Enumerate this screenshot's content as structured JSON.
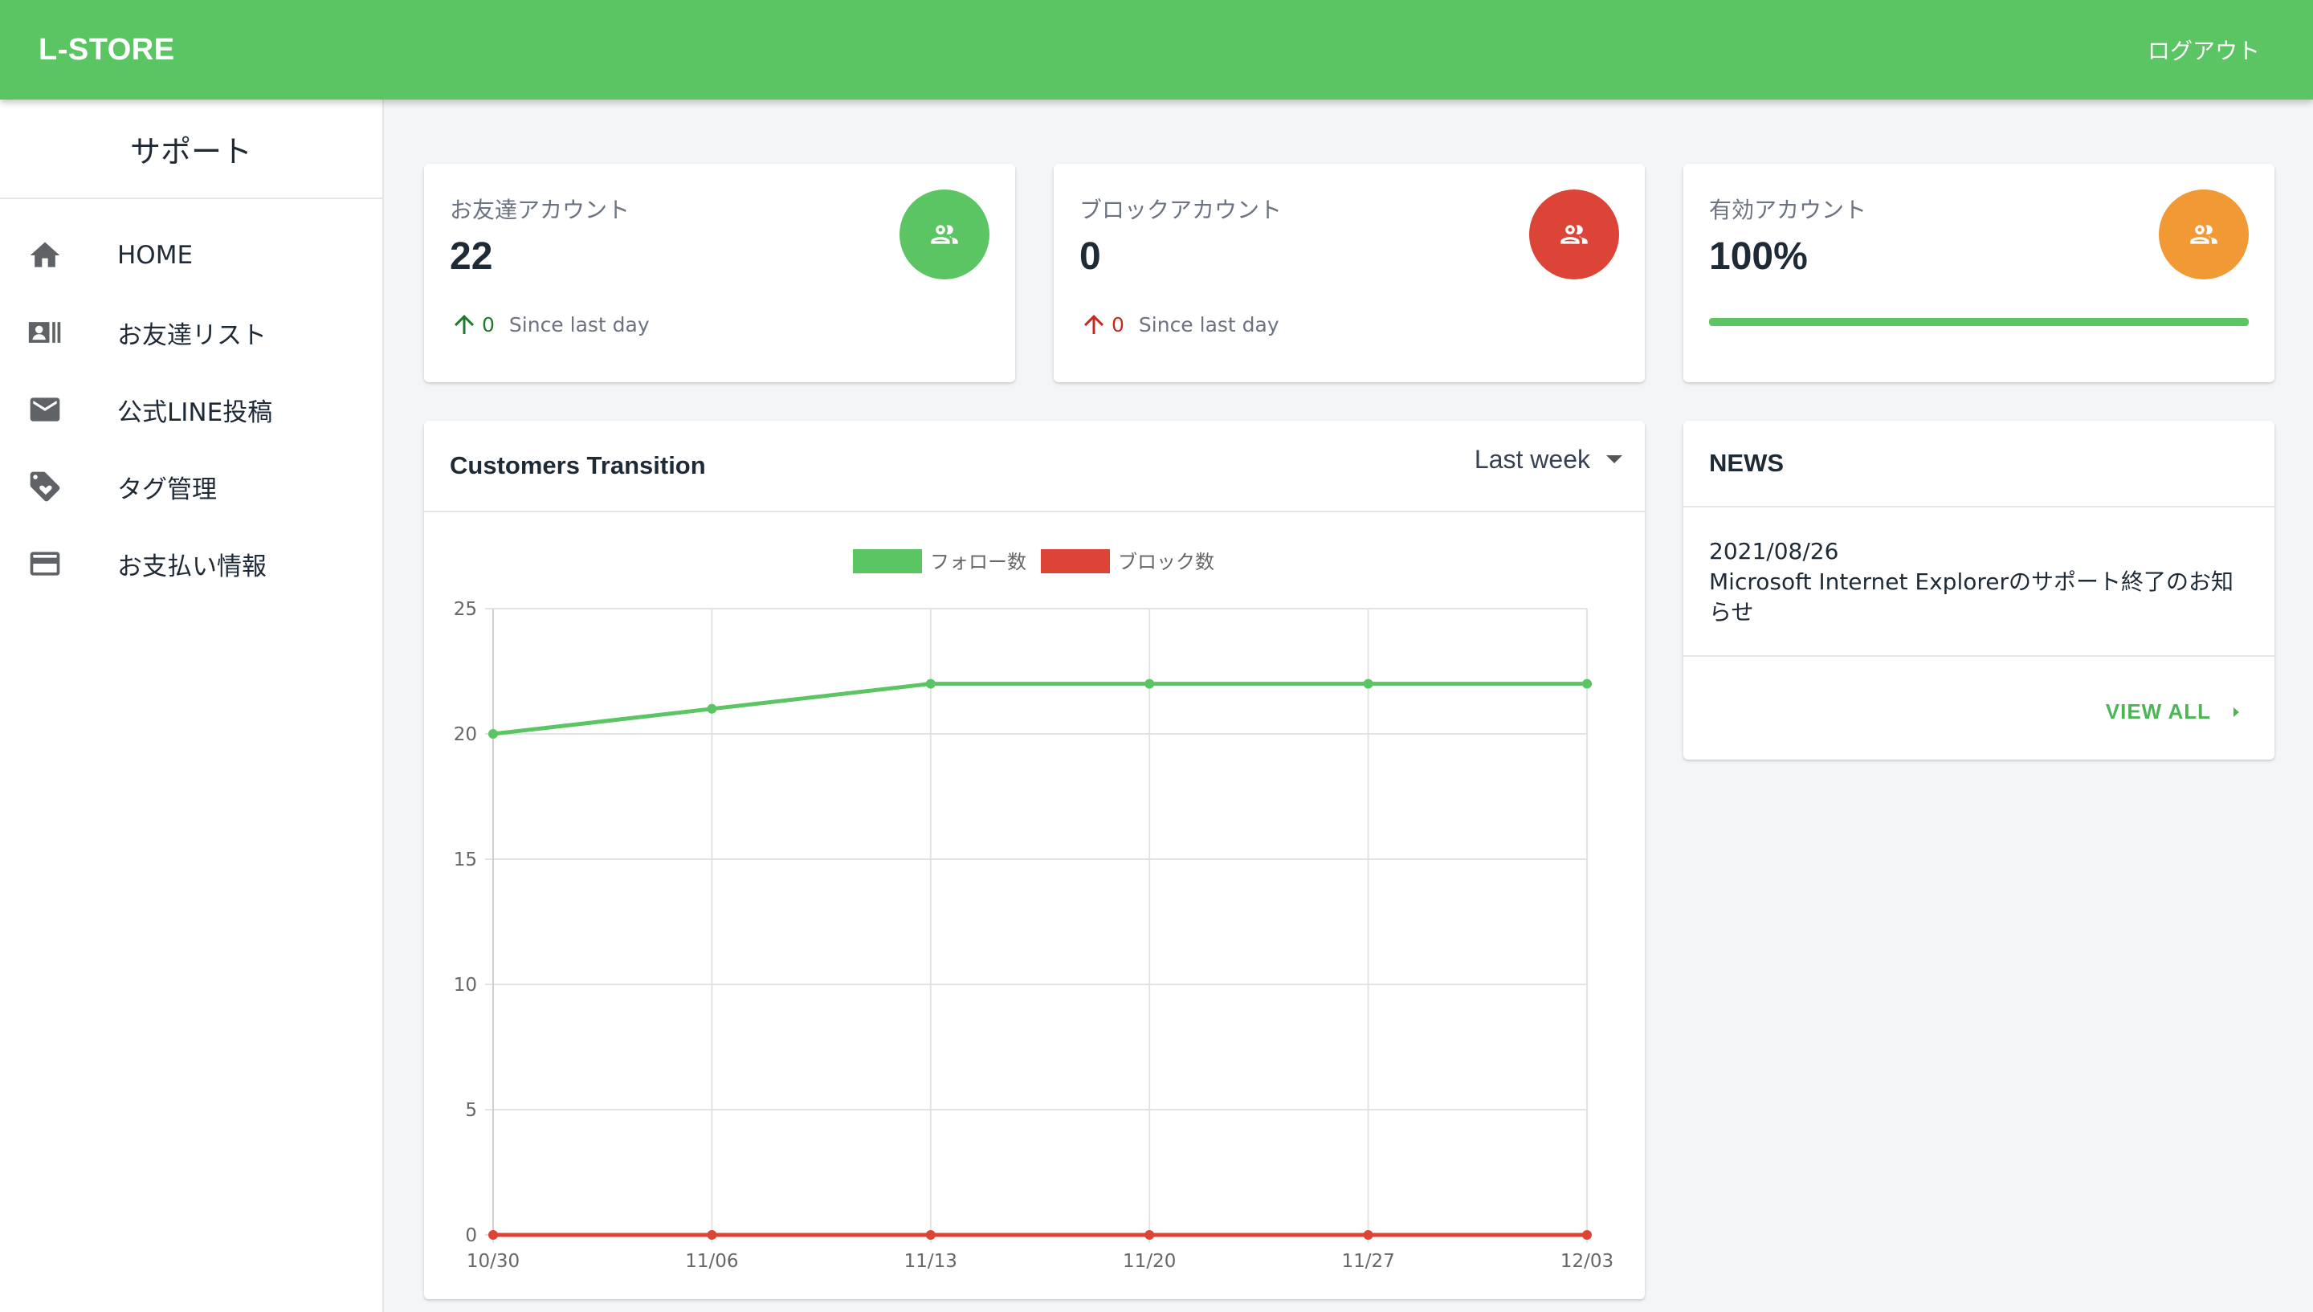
{
  "app": {
    "brand": "L-STORE",
    "logout_label": "ログアウト"
  },
  "sidebar": {
    "title": "サポート",
    "items": [
      {
        "label": "HOME",
        "icon": "home-icon"
      },
      {
        "label": "お友達リスト",
        "icon": "contacts-icon"
      },
      {
        "label": "公式LINE投稿",
        "icon": "mail-icon"
      },
      {
        "label": "タグ管理",
        "icon": "tag-icon"
      },
      {
        "label": "お支払い情報",
        "icon": "credit-card-icon"
      }
    ]
  },
  "stats": [
    {
      "title": "お友達アカウント",
      "value": "22",
      "delta": "0",
      "since": "Since last day",
      "color": "#5cc563",
      "delta_color": "#1e7a2c",
      "icon": "group-icon"
    },
    {
      "title": "ブロックアカウント",
      "value": "0",
      "delta": "0",
      "since": "Since last day",
      "color": "#db4437",
      "delta_color": "#c8281e",
      "icon": "group-icon"
    },
    {
      "title": "有効アカウント",
      "value": "100%",
      "progress": 1.0,
      "color": "#f19a35",
      "icon": "group-icon"
    }
  ],
  "chart_panel": {
    "title": "Customers Transition",
    "period": "Last week"
  },
  "news": {
    "title": "NEWS",
    "items": [
      {
        "date": "2021/08/26",
        "text": "Microsoft Internet Explorerのサポート終了のお知らせ"
      }
    ],
    "view_all": "VIEW ALL"
  },
  "chart_data": {
    "type": "line",
    "x": [
      "10/30",
      "11/06",
      "11/13",
      "11/20",
      "11/27",
      "12/03"
    ],
    "series": [
      {
        "name": "フォロー数",
        "color": "#5cc563",
        "values": [
          20,
          21,
          22,
          22,
          22,
          22
        ]
      },
      {
        "name": "ブロック数",
        "color": "#db4437",
        "values": [
          0,
          0,
          0,
          0,
          0,
          0
        ]
      }
    ],
    "ylim": [
      0,
      25
    ],
    "yticks": [
      0,
      5,
      10,
      15,
      20,
      25
    ],
    "grid": true,
    "legend": "top-center"
  }
}
